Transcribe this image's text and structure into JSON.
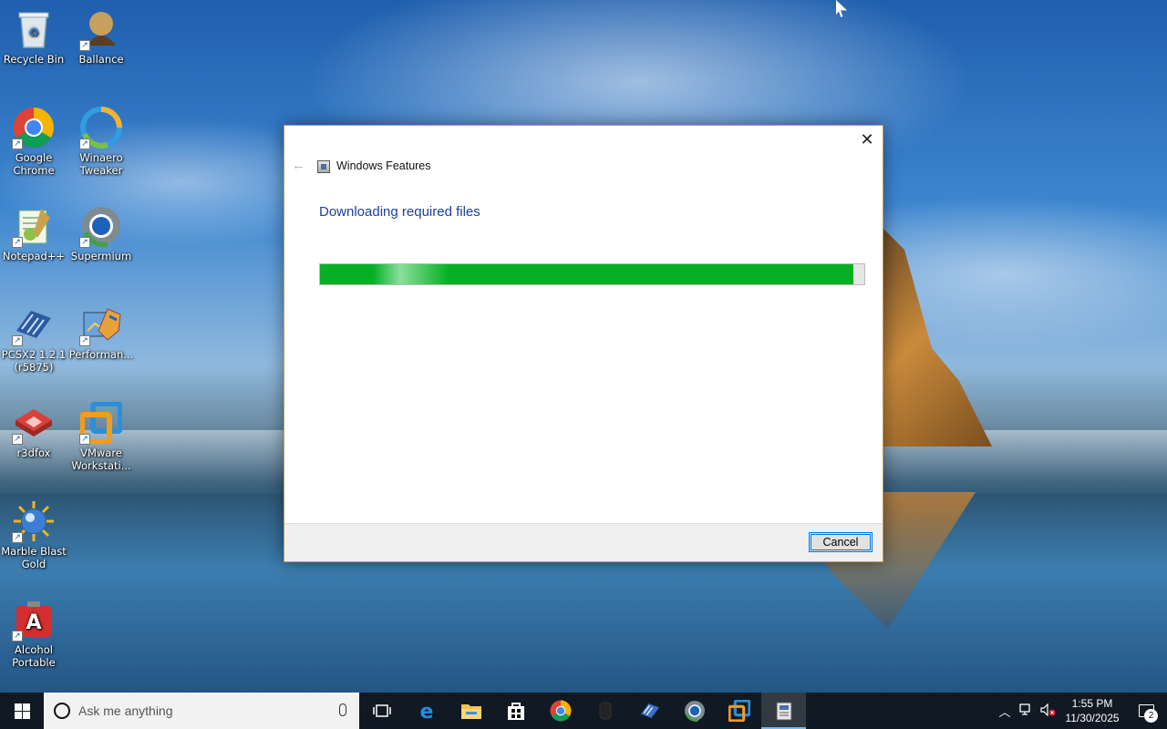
{
  "desktop": {
    "icons": [
      {
        "label": "Recycle Bin",
        "icon": "recycle-bin-icon"
      },
      {
        "label": "Ballance",
        "icon": "ballance-icon"
      },
      {
        "label": "Google Chrome",
        "icon": "chrome-icon"
      },
      {
        "label": "Winaero Tweaker",
        "icon": "winaero-tweaker-icon"
      },
      {
        "label": "Notepad++",
        "icon": "notepadpp-icon"
      },
      {
        "label": "Supermium",
        "icon": "supermium-icon"
      },
      {
        "label": "PCSX2 1.2.1 (r5875)",
        "icon": "pcsx2-icon"
      },
      {
        "label": "Performan...",
        "icon": "performance-icon"
      },
      {
        "label": "r3dfox",
        "icon": "r3dfox-icon"
      },
      {
        "label": "VMware Workstati...",
        "icon": "vmware-icon"
      },
      {
        "label": "Marble Blast Gold",
        "icon": "marble-blast-icon"
      },
      {
        "label": "Alcohol Portable",
        "icon": "alcohol-icon"
      }
    ]
  },
  "dialog": {
    "window_title": "Windows Features",
    "heading": "Downloading required files",
    "progress_fraction": 0.98,
    "cancel_label": "Cancel",
    "close_symbol": "✕",
    "back_symbol": "←"
  },
  "taskbar": {
    "search_placeholder": "Ask me anything",
    "pinned": [
      "task-view",
      "edge",
      "file-explorer",
      "store",
      "chrome",
      "unknown-app",
      "winaero-tweaker",
      "supermium",
      "vmware",
      "windows-features"
    ],
    "time": "1:55 PM",
    "date": "11/30/2025",
    "notification_count": "2"
  },
  "colors": {
    "progress_green": "#06b025",
    "heading_blue": "#1c3f94",
    "accent": "#0078d7"
  }
}
